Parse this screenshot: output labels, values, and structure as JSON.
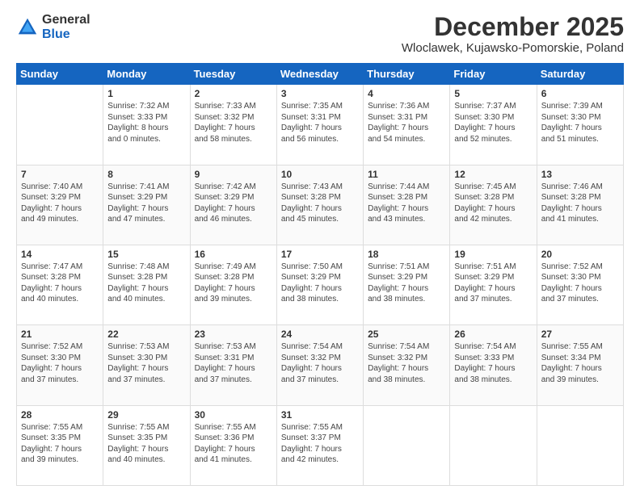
{
  "header": {
    "logo_general": "General",
    "logo_blue": "Blue",
    "main_title": "December 2025",
    "subtitle": "Wloclawek, Kujawsko-Pomorskie, Poland"
  },
  "weekdays": [
    "Sunday",
    "Monday",
    "Tuesday",
    "Wednesday",
    "Thursday",
    "Friday",
    "Saturday"
  ],
  "weeks": [
    [
      {
        "day": "",
        "info": ""
      },
      {
        "day": "1",
        "info": "Sunrise: 7:32 AM\nSunset: 3:33 PM\nDaylight: 8 hours\nand 0 minutes."
      },
      {
        "day": "2",
        "info": "Sunrise: 7:33 AM\nSunset: 3:32 PM\nDaylight: 7 hours\nand 58 minutes."
      },
      {
        "day": "3",
        "info": "Sunrise: 7:35 AM\nSunset: 3:31 PM\nDaylight: 7 hours\nand 56 minutes."
      },
      {
        "day": "4",
        "info": "Sunrise: 7:36 AM\nSunset: 3:31 PM\nDaylight: 7 hours\nand 54 minutes."
      },
      {
        "day": "5",
        "info": "Sunrise: 7:37 AM\nSunset: 3:30 PM\nDaylight: 7 hours\nand 52 minutes."
      },
      {
        "day": "6",
        "info": "Sunrise: 7:39 AM\nSunset: 3:30 PM\nDaylight: 7 hours\nand 51 minutes."
      }
    ],
    [
      {
        "day": "7",
        "info": "Sunrise: 7:40 AM\nSunset: 3:29 PM\nDaylight: 7 hours\nand 49 minutes."
      },
      {
        "day": "8",
        "info": "Sunrise: 7:41 AM\nSunset: 3:29 PM\nDaylight: 7 hours\nand 47 minutes."
      },
      {
        "day": "9",
        "info": "Sunrise: 7:42 AM\nSunset: 3:29 PM\nDaylight: 7 hours\nand 46 minutes."
      },
      {
        "day": "10",
        "info": "Sunrise: 7:43 AM\nSunset: 3:28 PM\nDaylight: 7 hours\nand 45 minutes."
      },
      {
        "day": "11",
        "info": "Sunrise: 7:44 AM\nSunset: 3:28 PM\nDaylight: 7 hours\nand 43 minutes."
      },
      {
        "day": "12",
        "info": "Sunrise: 7:45 AM\nSunset: 3:28 PM\nDaylight: 7 hours\nand 42 minutes."
      },
      {
        "day": "13",
        "info": "Sunrise: 7:46 AM\nSunset: 3:28 PM\nDaylight: 7 hours\nand 41 minutes."
      }
    ],
    [
      {
        "day": "14",
        "info": "Sunrise: 7:47 AM\nSunset: 3:28 PM\nDaylight: 7 hours\nand 40 minutes."
      },
      {
        "day": "15",
        "info": "Sunrise: 7:48 AM\nSunset: 3:28 PM\nDaylight: 7 hours\nand 40 minutes."
      },
      {
        "day": "16",
        "info": "Sunrise: 7:49 AM\nSunset: 3:28 PM\nDaylight: 7 hours\nand 39 minutes."
      },
      {
        "day": "17",
        "info": "Sunrise: 7:50 AM\nSunset: 3:29 PM\nDaylight: 7 hours\nand 38 minutes."
      },
      {
        "day": "18",
        "info": "Sunrise: 7:51 AM\nSunset: 3:29 PM\nDaylight: 7 hours\nand 38 minutes."
      },
      {
        "day": "19",
        "info": "Sunrise: 7:51 AM\nSunset: 3:29 PM\nDaylight: 7 hours\nand 37 minutes."
      },
      {
        "day": "20",
        "info": "Sunrise: 7:52 AM\nSunset: 3:30 PM\nDaylight: 7 hours\nand 37 minutes."
      }
    ],
    [
      {
        "day": "21",
        "info": "Sunrise: 7:52 AM\nSunset: 3:30 PM\nDaylight: 7 hours\nand 37 minutes."
      },
      {
        "day": "22",
        "info": "Sunrise: 7:53 AM\nSunset: 3:30 PM\nDaylight: 7 hours\nand 37 minutes."
      },
      {
        "day": "23",
        "info": "Sunrise: 7:53 AM\nSunset: 3:31 PM\nDaylight: 7 hours\nand 37 minutes."
      },
      {
        "day": "24",
        "info": "Sunrise: 7:54 AM\nSunset: 3:32 PM\nDaylight: 7 hours\nand 37 minutes."
      },
      {
        "day": "25",
        "info": "Sunrise: 7:54 AM\nSunset: 3:32 PM\nDaylight: 7 hours\nand 38 minutes."
      },
      {
        "day": "26",
        "info": "Sunrise: 7:54 AM\nSunset: 3:33 PM\nDaylight: 7 hours\nand 38 minutes."
      },
      {
        "day": "27",
        "info": "Sunrise: 7:55 AM\nSunset: 3:34 PM\nDaylight: 7 hours\nand 39 minutes."
      }
    ],
    [
      {
        "day": "28",
        "info": "Sunrise: 7:55 AM\nSunset: 3:35 PM\nDaylight: 7 hours\nand 39 minutes."
      },
      {
        "day": "29",
        "info": "Sunrise: 7:55 AM\nSunset: 3:35 PM\nDaylight: 7 hours\nand 40 minutes."
      },
      {
        "day": "30",
        "info": "Sunrise: 7:55 AM\nSunset: 3:36 PM\nDaylight: 7 hours\nand 41 minutes."
      },
      {
        "day": "31",
        "info": "Sunrise: 7:55 AM\nSunset: 3:37 PM\nDaylight: 7 hours\nand 42 minutes."
      },
      {
        "day": "",
        "info": ""
      },
      {
        "day": "",
        "info": ""
      },
      {
        "day": "",
        "info": ""
      }
    ]
  ]
}
